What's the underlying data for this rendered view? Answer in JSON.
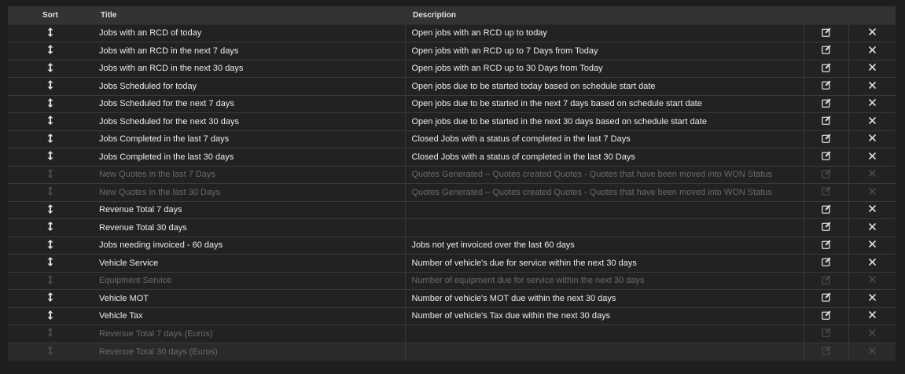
{
  "headers": {
    "sort": "Sort",
    "title": "Title",
    "description": "Description"
  },
  "colors": {
    "background": "#1e1e1e",
    "header": "#333333",
    "text": "#ececec",
    "disabled_text": "#6a6a6a"
  },
  "rows": [
    {
      "title": "Jobs with an RCD of today",
      "description": "Open jobs with an RCD up to today",
      "enabled": true
    },
    {
      "title": "Jobs with an RCD in the next 7 days",
      "description": "Open jobs with an RCD up to 7 Days from Today",
      "enabled": true
    },
    {
      "title": "Jobs with an RCD in the next 30 days",
      "description": "Open jobs with an RCD up to 30 Days from Today",
      "enabled": true
    },
    {
      "title": "Jobs Scheduled for today",
      "description": "Open jobs due to be started today based on schedule start date",
      "enabled": true
    },
    {
      "title": "Jobs Scheduled for the next 7 days",
      "description": "Open jobs due to be started in the next 7 days based on schedule start date",
      "enabled": true
    },
    {
      "title": "Jobs Scheduled for the next 30 days",
      "description": "Open jobs due to be started in the next 30 days based on schedule start date",
      "enabled": true
    },
    {
      "title": "Jobs Completed in the last 7 days",
      "description": "Closed Jobs with a status of completed in the last 7 Days",
      "enabled": true
    },
    {
      "title": "Jobs Completed in the last 30 days",
      "description": "Closed Jobs with a status of completed in the last 30 Days",
      "enabled": true
    },
    {
      "title": "New Quotes in the last 7 Days",
      "description": "Quotes Generated – Quotes created Quotes - Quotes that have been moved into WON Status",
      "enabled": false
    },
    {
      "title": "New Quotes in the last 30 Days",
      "description": "Quotes Generated – Quotes created Quotes - Quotes that have been moved into WON Status",
      "enabled": false
    },
    {
      "title": "Revenue Total 7 days",
      "description": "",
      "enabled": true
    },
    {
      "title": "Revenue Total 30 days",
      "description": "",
      "enabled": true
    },
    {
      "title": "Jobs needing invoiced - 60 days",
      "description": "Jobs not yet invoiced over the last 60 days",
      "enabled": true
    },
    {
      "title": "Vehicle Service",
      "description": "Number of vehicle's due for service within the next 30 days",
      "enabled": true
    },
    {
      "title": "Equipment Service",
      "description": "Number of equipment due for service within the next 30 days",
      "enabled": false
    },
    {
      "title": "Vehicle MOT",
      "description": "Number of vehicle's MOT due within the next 30 days",
      "enabled": true
    },
    {
      "title": "Vehicle Tax",
      "description": "Number of vehicle's Tax due within the next 30 days",
      "enabled": true
    },
    {
      "title": "Revenue Total 7 days (Euros)",
      "description": "",
      "enabled": false
    },
    {
      "title": "Revenue Total 30 days (Euros)",
      "description": "",
      "enabled": false
    }
  ]
}
